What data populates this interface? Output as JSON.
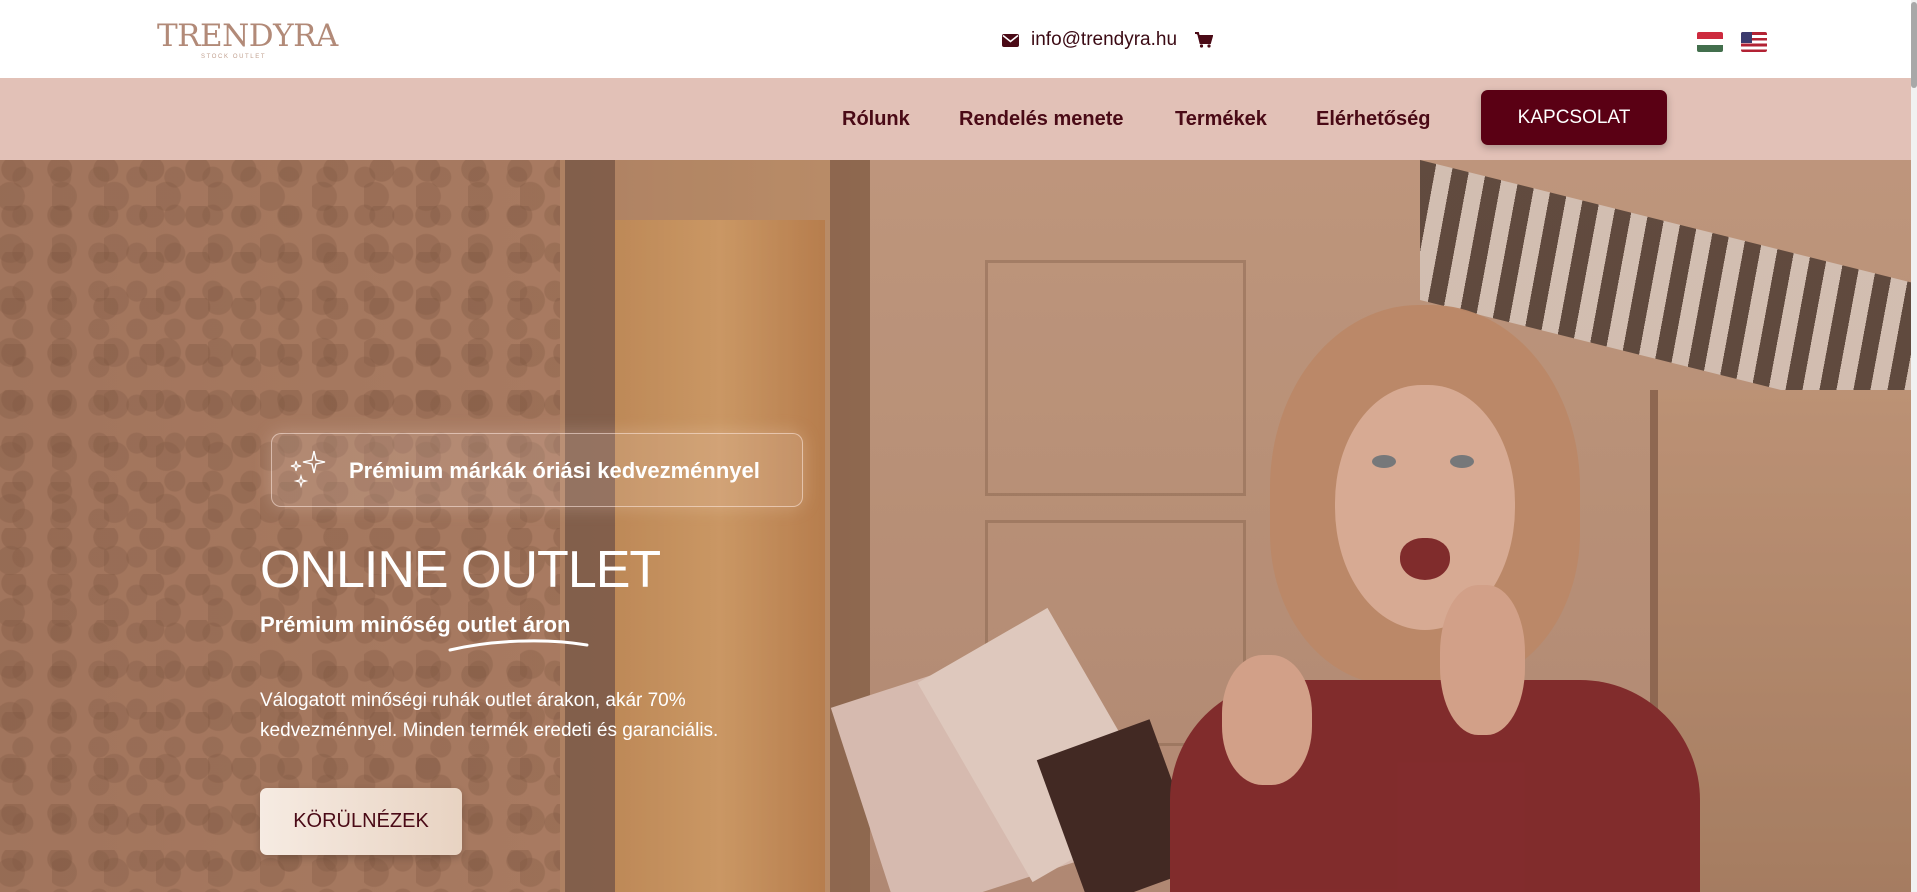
{
  "header": {
    "logo": {
      "text": "TRENDYRA",
      "subtext": "STOCK OUTLET"
    },
    "email": "info@trendyra.hu",
    "icons": [
      "envelope-icon",
      "cart-icon"
    ],
    "languages": [
      "hu",
      "en-us"
    ]
  },
  "nav": {
    "items": [
      "Rólunk",
      "Rendelés menete",
      "Termékek",
      "Elérhetőség"
    ],
    "cta_label": "KAPCSOLAT"
  },
  "hero": {
    "badge": "Prémium márkák óriási kedvezménnyel",
    "title": "ONLINE OUTLET",
    "subtitle": "Prémium minőség outlet áron",
    "description": "Válogatott minőségi ruhák outlet árakon, akár 70% kedvezménnyel. Minden termék eredeti és garanciális.",
    "button_label": "KÖRÜLNÉZEK"
  },
  "colors": {
    "brand_dark": "#5a0014",
    "nav_bg": "#e2c1b7",
    "logo": "#b28a78",
    "button_light": "#f6ebe2"
  }
}
